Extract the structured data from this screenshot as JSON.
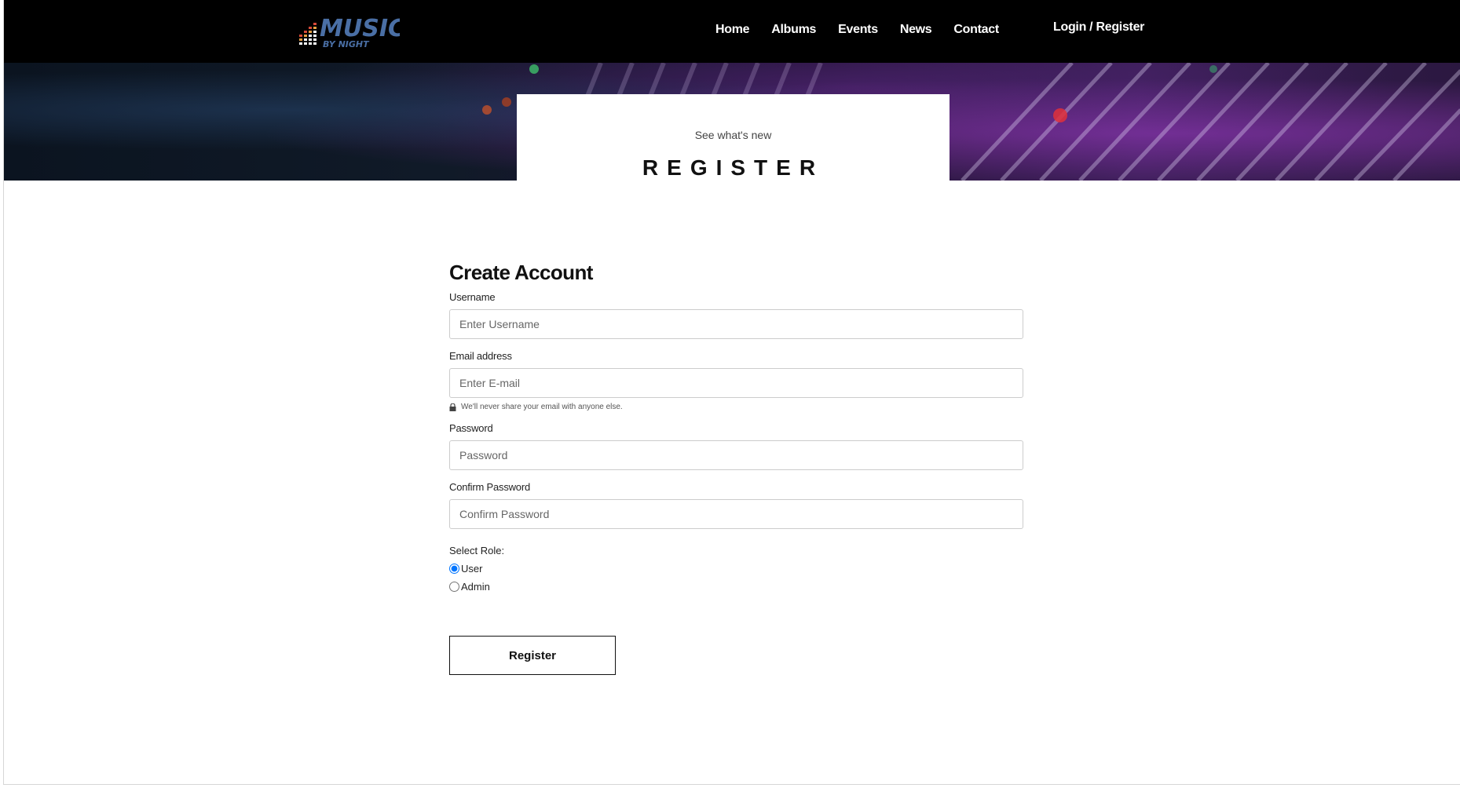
{
  "brand": {
    "logo_text": "MUSIC",
    "logo_subtext": "BY NIGHT"
  },
  "nav": {
    "items": [
      {
        "label": "Home"
      },
      {
        "label": "Albums"
      },
      {
        "label": "Events"
      },
      {
        "label": "News"
      },
      {
        "label": "Contact"
      }
    ],
    "login_label": "Login / Register"
  },
  "hero": {
    "subtitle": "See what's new",
    "title": "REGISTER"
  },
  "form": {
    "title": "Create Account",
    "username": {
      "label": "Username",
      "placeholder": "Enter Username",
      "value": ""
    },
    "email": {
      "label": "Email address",
      "placeholder": "Enter E-mail",
      "value": "",
      "hint": "We'll never share your email with anyone else."
    },
    "password": {
      "label": "Password",
      "placeholder": "Password",
      "value": ""
    },
    "confirm_password": {
      "label": "Confirm Password",
      "placeholder": "Confirm Password",
      "value": ""
    },
    "role": {
      "label": "Select Role:",
      "options": [
        {
          "label": "User",
          "selected": true
        },
        {
          "label": "Admin",
          "selected": false
        }
      ]
    },
    "submit_label": "Register"
  },
  "colors": {
    "navbar_bg": "#000000",
    "logo_blue": "#4a6fa5",
    "text_dark": "#111111",
    "input_border": "#cccccc"
  }
}
